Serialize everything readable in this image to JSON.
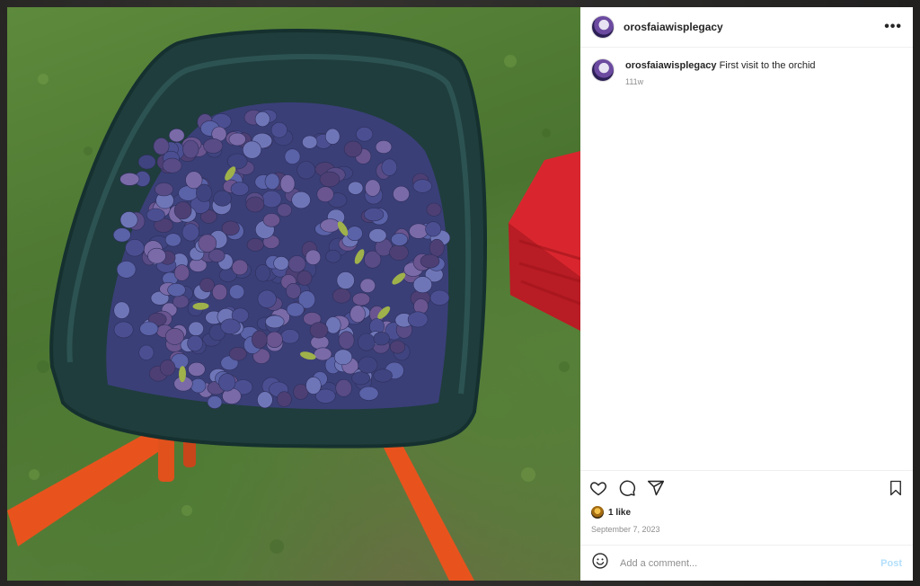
{
  "post": {
    "username": "orosfaiawisplegacy",
    "caption_user": "orosfaiawisplegacy",
    "caption_text": "First visit to the orchid",
    "age": "111w",
    "likes": "1 like",
    "date": "September 7, 2023"
  },
  "comment_box": {
    "placeholder": "Add a comment...",
    "post_label": "Post"
  },
  "icons": {
    "more": "more-options-icon",
    "like": "heart-icon",
    "comment": "comment-icon",
    "share": "share-icon",
    "save": "bookmark-icon",
    "emoji": "emoji-icon"
  },
  "colors": {
    "text": "#262626",
    "muted": "#8e8e8e",
    "post_disabled": "#b2dffc",
    "divider": "#efefef"
  }
}
